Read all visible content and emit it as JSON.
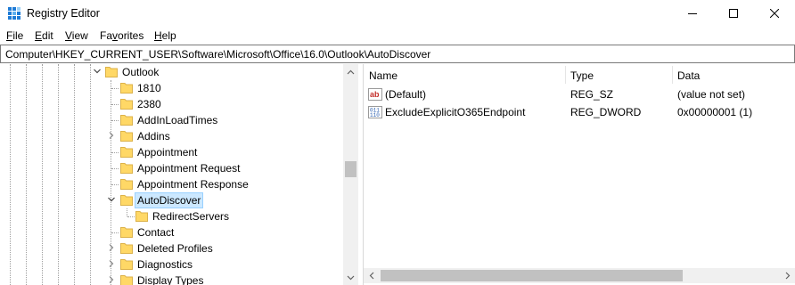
{
  "window": {
    "title": "Registry Editor",
    "controls": [
      "minimize",
      "maximize",
      "close"
    ]
  },
  "menu": [
    {
      "label_pre": "",
      "label_ul": "F",
      "label_post": "ile"
    },
    {
      "label_pre": "",
      "label_ul": "E",
      "label_post": "dit"
    },
    {
      "label_pre": "",
      "label_ul": "V",
      "label_post": "iew"
    },
    {
      "label_pre": "Fa",
      "label_ul": "v",
      "label_post": "orites"
    },
    {
      "label_pre": "",
      "label_ul": "H",
      "label_post": "elp"
    }
  ],
  "address": "Computer\\HKEY_CURRENT_USER\\Software\\Microsoft\\Office\\16.0\\Outlook\\AutoDiscover",
  "tree": {
    "parent": {
      "label": "Outlook",
      "expanded": true
    },
    "items": [
      {
        "label": "1810",
        "has_children": false
      },
      {
        "label": "2380",
        "has_children": false
      },
      {
        "label": "AddInLoadTimes",
        "has_children": false
      },
      {
        "label": "Addins",
        "has_children": true
      },
      {
        "label": "Appointment",
        "has_children": false
      },
      {
        "label": "Appointment Request",
        "has_children": false
      },
      {
        "label": "Appointment Response",
        "has_children": false
      },
      {
        "label": "AutoDiscover",
        "has_children": true,
        "expanded": true,
        "selected": true
      },
      {
        "label": "RedirectServers",
        "has_children": false,
        "child": true
      },
      {
        "label": "Contact",
        "has_children": false
      },
      {
        "label": "Deleted Profiles",
        "has_children": true
      },
      {
        "label": "Diagnostics",
        "has_children": true
      },
      {
        "label": "Display Types",
        "has_children": true
      }
    ]
  },
  "list": {
    "columns": [
      "Name",
      "Type",
      "Data"
    ],
    "rows": [
      {
        "icon": "string-value-icon",
        "name": "(Default)",
        "type": "REG_SZ",
        "data": "(value not set)"
      },
      {
        "icon": "binary-value-icon",
        "name": "ExcludeExplicitO365Endpoint",
        "type": "REG_DWORD",
        "data": "0x00000001 (1)"
      }
    ]
  },
  "colors": {
    "folder": "#ffd866",
    "folder_edge": "#dcb24a",
    "selection_bg": "#cce8ff",
    "selection_border": "#99d1ff",
    "scrollbar_track": "#f0f0f0",
    "scrollbar_thumb": "#c1c1c1"
  }
}
